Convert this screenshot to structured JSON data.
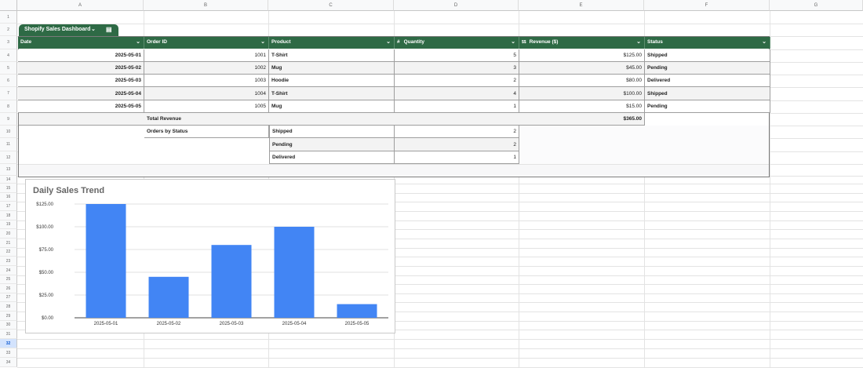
{
  "columns": [
    "A",
    "B",
    "C",
    "D",
    "E",
    "F",
    "G"
  ],
  "rows": [
    "1",
    "2",
    "3",
    "4",
    "5",
    "6",
    "7",
    "8",
    "9",
    "10",
    "11",
    "12",
    "13",
    "14",
    "15",
    "16",
    "17",
    "18",
    "19",
    "20",
    "21",
    "22",
    "23",
    "24",
    "25",
    "26",
    "27",
    "28",
    "29",
    "30",
    "31",
    "32",
    "33",
    "34"
  ],
  "table": {
    "name": "Shopify Sales Dashboard",
    "headers": [
      "Date",
      "Order ID",
      "Product",
      "Quantity",
      "Revenue ($)",
      "Status"
    ],
    "rows": [
      {
        "date": "2025-05-01",
        "order_id": "1001",
        "product": "T-Shirt",
        "quantity": "5",
        "revenue": "$125.00",
        "status": "Shipped"
      },
      {
        "date": "2025-05-02",
        "order_id": "1002",
        "product": "Mug",
        "quantity": "3",
        "revenue": "$45.00",
        "status": "Pending"
      },
      {
        "date": "2025-05-03",
        "order_id": "1003",
        "product": "Hoodie",
        "quantity": "2",
        "revenue": "$80.00",
        "status": "Delivered"
      },
      {
        "date": "2025-05-04",
        "order_id": "1004",
        "product": "T-Shirt",
        "quantity": "4",
        "revenue": "$100.00",
        "status": "Shipped"
      },
      {
        "date": "2025-05-05",
        "order_id": "1005",
        "product": "Mug",
        "quantity": "1",
        "revenue": "$15.00",
        "status": "Pending"
      }
    ],
    "total_label": "Total Revenue",
    "total_value": "$365.00",
    "status_label": "Orders by Status",
    "status_counts": [
      {
        "status": "Shipped",
        "count": "2"
      },
      {
        "status": "Pending",
        "count": "2"
      },
      {
        "status": "Delivered",
        "count": "1"
      }
    ]
  },
  "icons": {
    "table_menu": "chevron-down-icon",
    "table_view": "table-view-icon",
    "number_type": "hash-icon",
    "currency_type": "currency-icon"
  },
  "colors": {
    "header_green": "#2e6a45",
    "bar_blue": "#4285f4"
  },
  "chart_data": {
    "type": "bar",
    "title": "Daily Sales Trend",
    "categories": [
      "2025-05-01",
      "2025-05-02",
      "2025-05-03",
      "2025-05-04",
      "2025-05-05"
    ],
    "values": [
      125,
      45,
      80,
      100,
      15
    ],
    "ylim": [
      0,
      125
    ],
    "yticks": [
      "$0.00",
      "$25.00",
      "$50.00",
      "$75.00",
      "$100.00",
      "$125.00"
    ],
    "xlabel": "",
    "ylabel": "",
    "grid": true
  }
}
